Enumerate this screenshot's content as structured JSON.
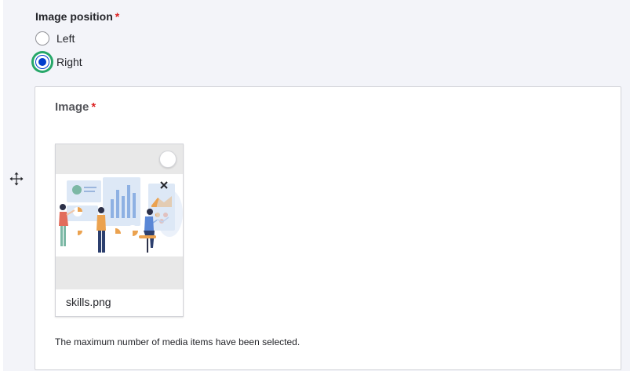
{
  "image_position": {
    "label": "Image position",
    "required_mark": "*",
    "options": [
      {
        "label": "Left",
        "checked": false
      },
      {
        "label": "Right",
        "checked": true
      }
    ]
  },
  "image_field": {
    "legend": "Image",
    "required_mark": "*",
    "media_item": {
      "filename": "skills.png",
      "remove_icon": "close-icon",
      "thumbnail_description": "illustration of people with charts"
    },
    "description": "The maximum number of media items have been selected.",
    "drag_icon": "move-icon"
  },
  "colors": {
    "accent": "#003ecc",
    "focus_ring": "#26a769",
    "required": "#dc2323",
    "background": "#f3f4f9"
  }
}
